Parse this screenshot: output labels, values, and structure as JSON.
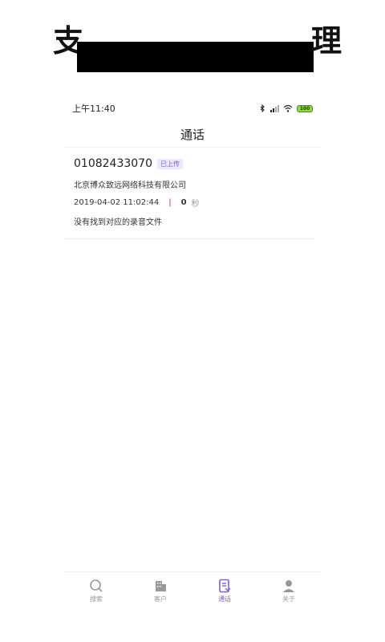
{
  "banner": {
    "title": "支",
    "title_tail": "理"
  },
  "status_bar": {
    "time": "上午11:40",
    "battery": "100"
  },
  "header": {
    "title": "通话"
  },
  "call": {
    "number": "01082433070",
    "badge": "已上传",
    "company": "北京博众致远网络科技有限公司",
    "datetime": "2019-04-02 11:02:44",
    "separator": "|",
    "duration": "0",
    "duration_unit": "秒",
    "note": "没有找到对应的录音文件"
  },
  "tabs": [
    {
      "label": "搜索",
      "icon": "search-icon"
    },
    {
      "label": "客户",
      "icon": "building-icon"
    },
    {
      "label": "通话",
      "icon": "call-log-icon",
      "active": true
    },
    {
      "label": "关于",
      "icon": "user-icon"
    }
  ],
  "colors": {
    "accent": "#7d62c9",
    "inactive": "#999999"
  }
}
